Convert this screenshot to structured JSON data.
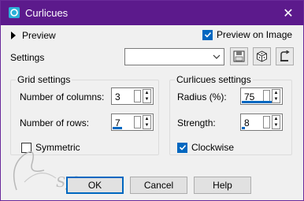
{
  "window": {
    "title": "Curlicues"
  },
  "preview": {
    "label": "Preview",
    "preview_on_image_label": "Preview on Image",
    "preview_on_image_checked": true
  },
  "settings": {
    "label": "Settings",
    "preset_value": ""
  },
  "grid": {
    "title": "Grid settings",
    "columns_label": "Number of columns:",
    "columns_value": "3",
    "rows_label": "Number of rows:",
    "rows_value": "7",
    "symmetric_label": "Symmetric",
    "symmetric_checked": false
  },
  "curlicues": {
    "title": "Curlicues settings",
    "radius_label": "Radius (%):",
    "radius_value": "75",
    "strength_label": "Strength:",
    "strength_value": "8",
    "clockwise_label": "Clockwise",
    "clockwise_checked": true
  },
  "buttons": {
    "ok": "OK",
    "cancel": "Cancel",
    "help": "Help"
  },
  "watermark": {
    "text": "Sylviane"
  },
  "colors": {
    "titlebar": "#5c1a8c",
    "accent": "#0067c0"
  },
  "icons": [
    "app-icon",
    "close-icon",
    "expand-triangle-icon",
    "save-icon",
    "randomize-icon",
    "reset-icon",
    "dropdown-chevron-icon",
    "spin-up-icon",
    "spin-down-icon",
    "checkmark-icon"
  ]
}
